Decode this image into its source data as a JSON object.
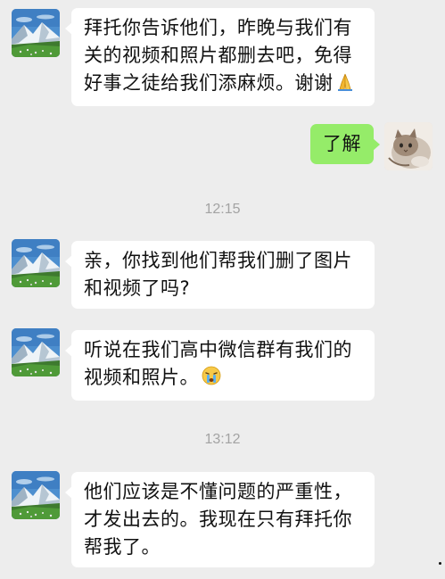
{
  "messages": [
    {
      "sender": "contact",
      "avatar": "mountain-landscape",
      "text": "拜托你告诉他们，昨晚与我们有关的视频和照片都删去吧，免得好事之徒给我们添麻烦。谢谢",
      "emoji": "folded-hands-emoji"
    },
    {
      "sender": "self",
      "avatar": "cat-photo",
      "text": "了解"
    },
    {
      "sender": "contact",
      "avatar": "mountain-landscape",
      "text": "亲，你找到他们帮我们删了图片和视频了吗?"
    },
    {
      "sender": "contact",
      "avatar": "mountain-landscape",
      "text": "听说在我们高中微信群有我们的视频和照片。",
      "emoji": "crying-face-emoji"
    },
    {
      "sender": "contact",
      "avatar": "mountain-landscape",
      "text": "他们应该是不懂问题的严重性，才发出去的。我现在只有拜托你帮我了。"
    }
  ],
  "timestamps": [
    "12:15",
    "13:12"
  ],
  "colors": {
    "background": "#ededed",
    "incoming_bubble": "#ffffff",
    "outgoing_bubble": "#95ec69",
    "timestamp_text": "#a3a3a3"
  }
}
